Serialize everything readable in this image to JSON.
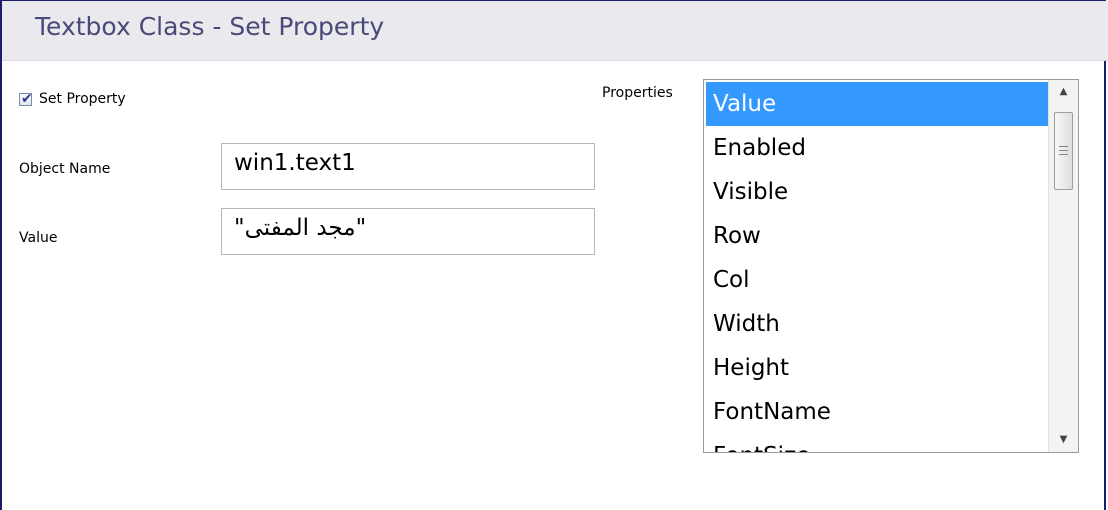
{
  "header": {
    "title": "Textbox Class - Set Property"
  },
  "form": {
    "set_property": {
      "label": "Set Property",
      "checked": true
    },
    "object_name": {
      "label": "Object Name",
      "value": "win1.text1"
    },
    "value": {
      "label": "Value",
      "value": "\"مجد المفتى\""
    }
  },
  "properties": {
    "label": "Properties",
    "items": [
      "Value",
      "Enabled",
      "Visible",
      "Row",
      "Col",
      "Width",
      "Height",
      "FontName",
      "FontSize"
    ],
    "selected": "Value"
  },
  "icons": {
    "checkbox_tick": "checkmark-icon",
    "scroll_up": "arrow-up-icon",
    "scroll_down": "arrow-down-icon"
  },
  "colors": {
    "title_text": "#4a4a78",
    "header_bg": "#e9e9ee",
    "selection": "#3399ff",
    "frame": "#1c1c6e"
  }
}
